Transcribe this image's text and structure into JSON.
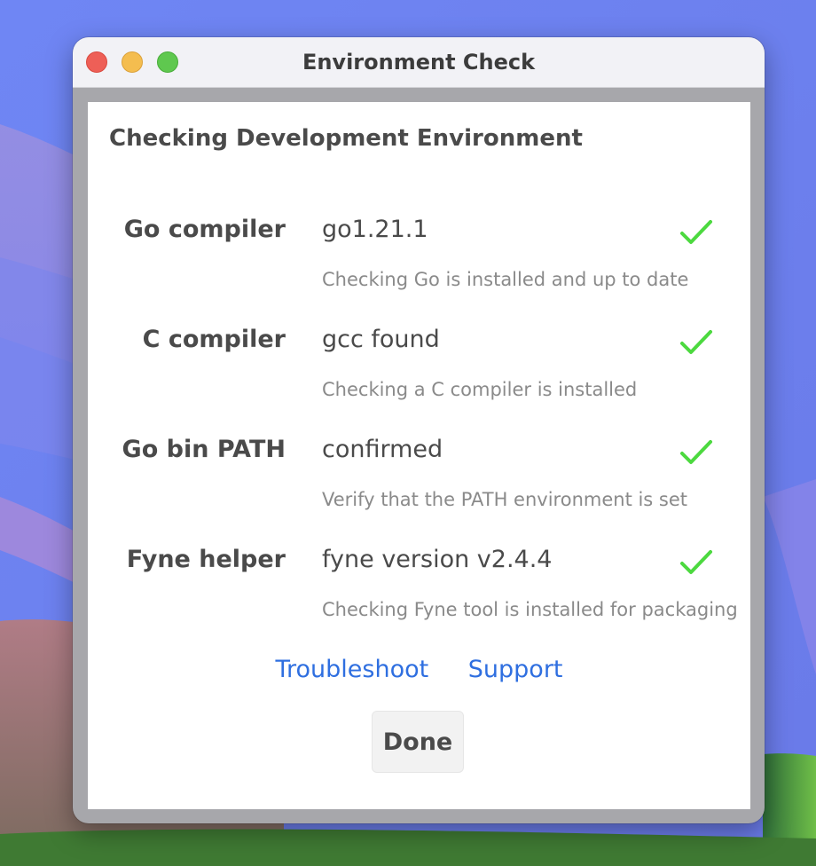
{
  "window": {
    "title": "Environment Check"
  },
  "heading": "Checking Development Environment",
  "checks": [
    {
      "label": "Go compiler",
      "value": "go1.21.1",
      "description": "Checking Go is installed and up to date",
      "status": "ok",
      "icon": "checkmark-icon"
    },
    {
      "label": "C compiler",
      "value": "gcc found",
      "description": "Checking a C compiler is installed",
      "status": "ok",
      "icon": "checkmark-icon"
    },
    {
      "label": "Go bin PATH",
      "value": "confirmed",
      "description": "Verify that the PATH environment is set",
      "status": "ok",
      "icon": "checkmark-icon"
    },
    {
      "label": "Fyne helper",
      "value": "fyne version v2.4.4",
      "description": "Checking Fyne tool is installed for packaging",
      "status": "ok",
      "icon": "checkmark-icon"
    }
  ],
  "links": {
    "troubleshoot": "Troubleshoot",
    "support": "Support"
  },
  "buttons": {
    "done": "Done"
  },
  "colors": {
    "check_ok": "#4cd93f",
    "link": "#2f6fe0",
    "traffic_close": "#ee5f57",
    "traffic_minimize": "#f4bd4f",
    "traffic_maximize": "#5fc84f"
  }
}
